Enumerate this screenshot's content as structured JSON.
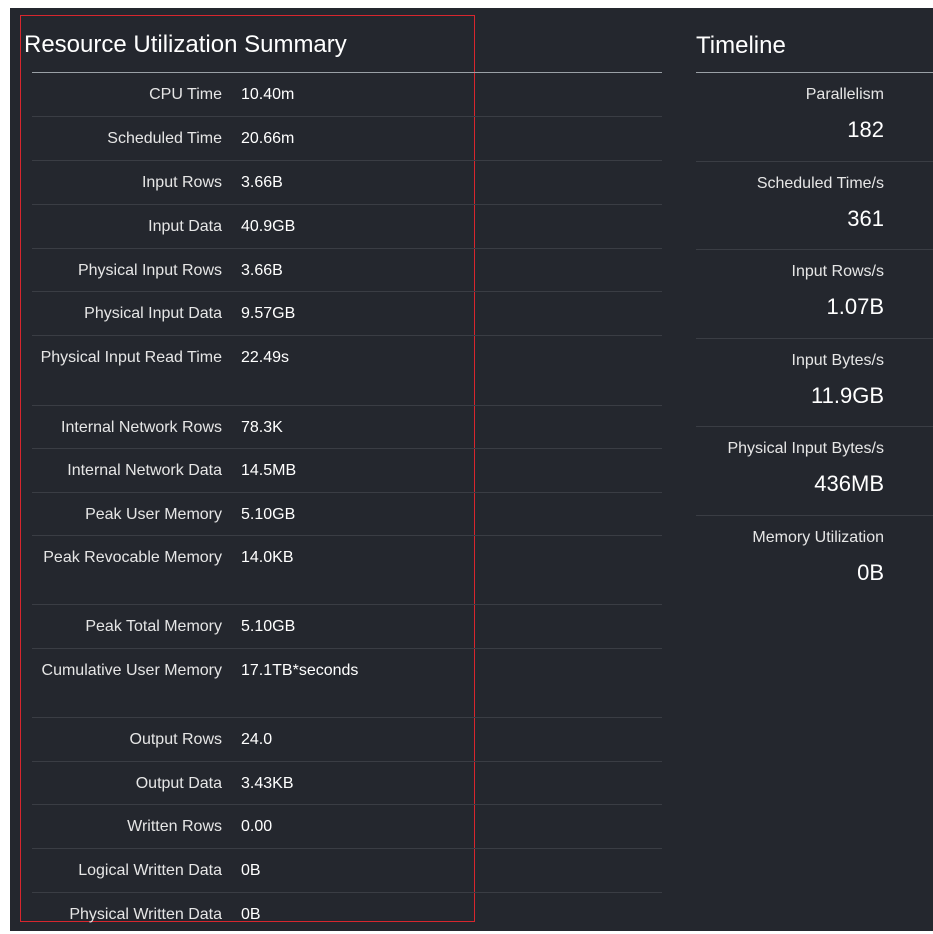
{
  "summary": {
    "title": "Resource Utilization Summary",
    "rows": [
      {
        "label": "CPU Time",
        "value": "10.40m"
      },
      {
        "label": "Scheduled Time",
        "value": "20.66m"
      },
      {
        "label": "Input Rows",
        "value": "3.66B"
      },
      {
        "label": "Input Data",
        "value": "40.9GB"
      },
      {
        "label": "Physical Input Rows",
        "value": "3.66B"
      },
      {
        "label": "Physical Input Data",
        "value": "9.57GB"
      },
      {
        "label": "Physical Input Read Time",
        "value": "22.49s"
      },
      {
        "label": "Internal Network Rows",
        "value": "78.3K"
      },
      {
        "label": "Internal Network Data",
        "value": "14.5MB"
      },
      {
        "label": "Peak User Memory",
        "value": "5.10GB"
      },
      {
        "label": "Peak Revocable Memory",
        "value": "14.0KB"
      },
      {
        "label": "Peak Total Memory",
        "value": "5.10GB"
      },
      {
        "label": "Cumulative User Memory",
        "value": "17.1TB*seconds"
      },
      {
        "label": "Output Rows",
        "value": "24.0"
      },
      {
        "label": "Output Data",
        "value": "3.43KB"
      },
      {
        "label": "Written Rows",
        "value": "0.00"
      },
      {
        "label": "Logical Written Data",
        "value": "0B"
      },
      {
        "label": "Physical Written Data",
        "value": "0B"
      }
    ]
  },
  "timeline": {
    "title": "Timeline",
    "items": [
      {
        "label": "Parallelism",
        "value": "182"
      },
      {
        "label": "Scheduled Time/s",
        "value": "361"
      },
      {
        "label": "Input Rows/s",
        "value": "1.07B"
      },
      {
        "label": "Input Bytes/s",
        "value": "11.9GB"
      },
      {
        "label": "Physical Input Bytes/s",
        "value": "436MB"
      },
      {
        "label": "Memory Utilization",
        "value": "0B"
      }
    ]
  },
  "colors": {
    "background": "#24272e",
    "highlight_border": "#d7262e",
    "rule": "#9aa0a6",
    "row_separator": "#3a3d44"
  }
}
